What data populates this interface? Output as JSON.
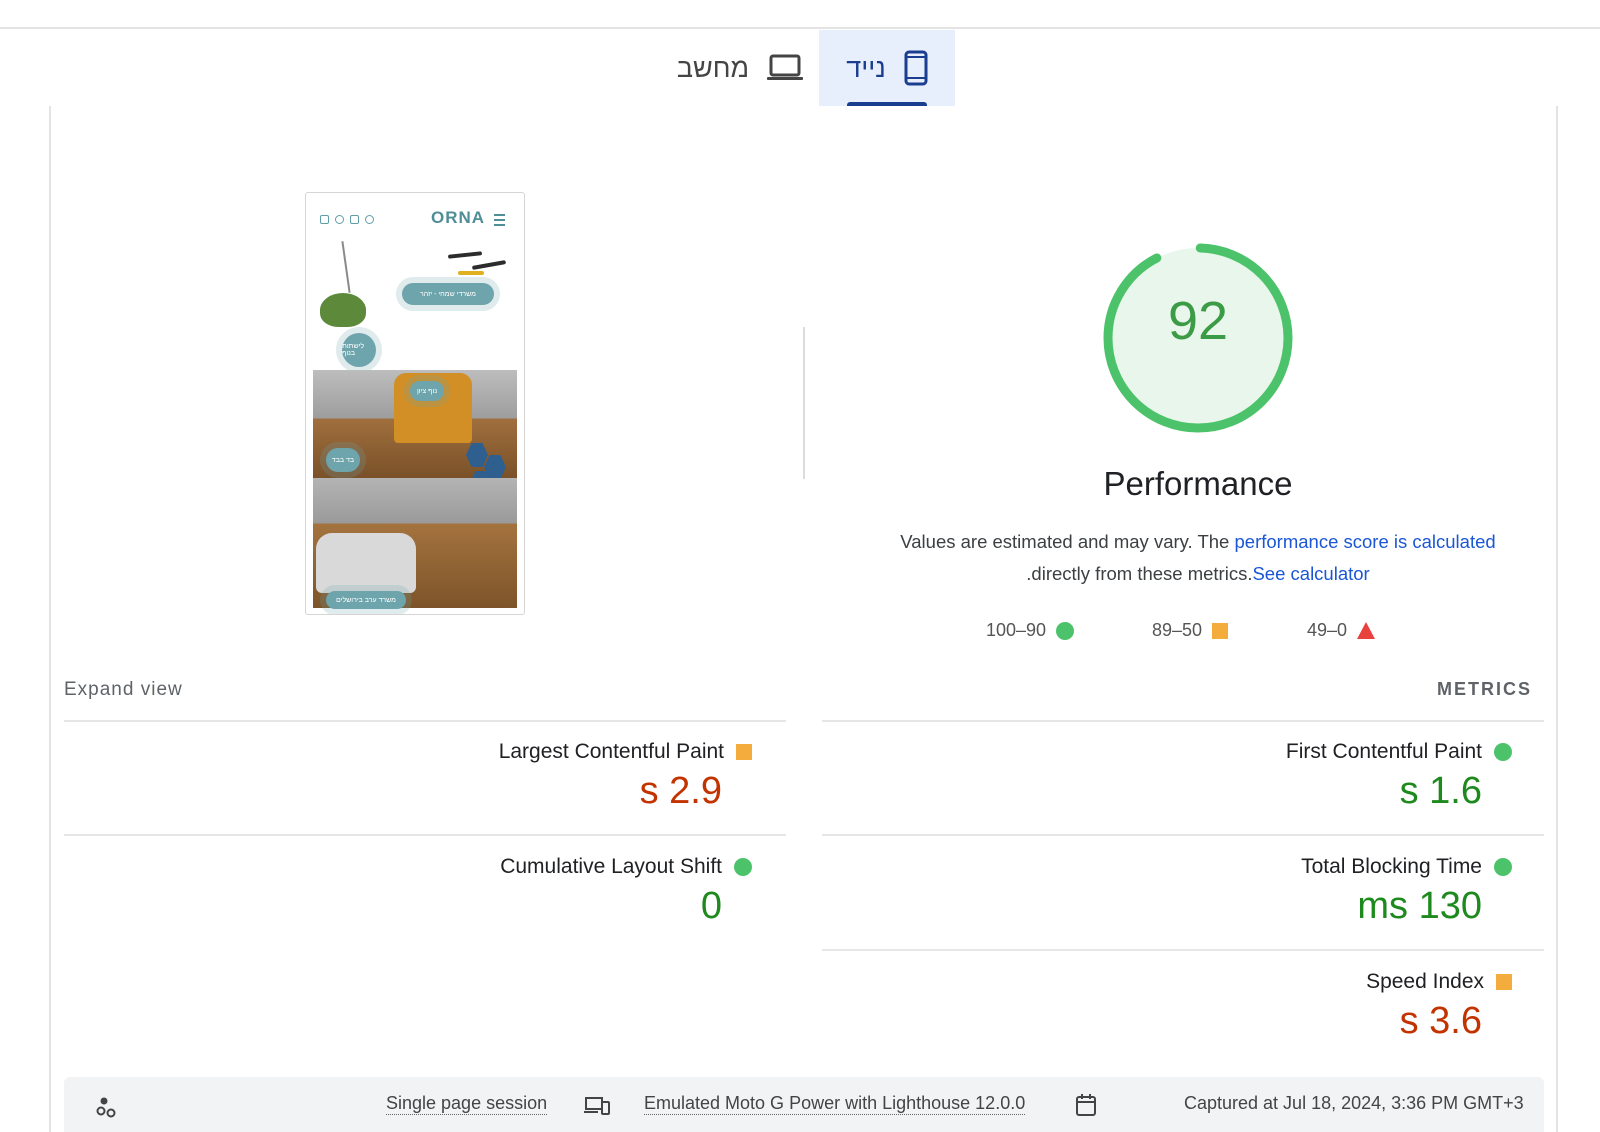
{
  "tabs": {
    "desktop_label": "מחשב",
    "mobile_label": "נייד",
    "desktop_icon": "laptop-icon",
    "mobile_icon": "smartphone-icon",
    "selected": "mobile"
  },
  "screenshot": {
    "logo": "ORNA",
    "pill_1": "משרדי שמחי - יזהר",
    "pill_2": "לישתות בנוף",
    "pill_3": "נוף ציון",
    "pill_4": "בד בבד",
    "pill_5": "משרד ערב בירושלים"
  },
  "score": {
    "value": "92",
    "fraction": 0.92,
    "color": "#4cc36a"
  },
  "performance": {
    "title": "Performance",
    "desc_prefix": "Values are estimated and may vary. The",
    "desc_link": "performance score is calculated",
    "desc_suffix": ".directly from these metrics.",
    "calculator_link": "See calculator"
  },
  "legend": {
    "good": "100–90",
    "average": "89–50",
    "poor": "49–0"
  },
  "metrics_header": {
    "expand": "Expand view",
    "title": "METRICS"
  },
  "metrics": {
    "fcp": {
      "name": "First Contentful Paint",
      "value": "s 1.6",
      "status": "good"
    },
    "lcp": {
      "name": "Largest Contentful Paint",
      "value": "s 2.9",
      "status": "average"
    },
    "tbt": {
      "name": "Total Blocking Time",
      "value": "ms 130",
      "status": "good"
    },
    "cls": {
      "name": "Cumulative Layout Shift",
      "value": "0",
      "status": "good"
    },
    "si": {
      "name": "Speed Index",
      "value": "s 3.6",
      "status": "average"
    }
  },
  "colors": {
    "good": "#4cc36a",
    "average": "#f4ad3d",
    "poor": "#e9413d",
    "link": "#1a56d6",
    "tab_active": "#1a3e8f"
  },
  "footer": {
    "session": "Single page session",
    "device": "Emulated Moto G Power with Lighthouse 12.0.0",
    "captured": "Captured at Jul 18, 2024, 3:36 PM GMT+3"
  }
}
